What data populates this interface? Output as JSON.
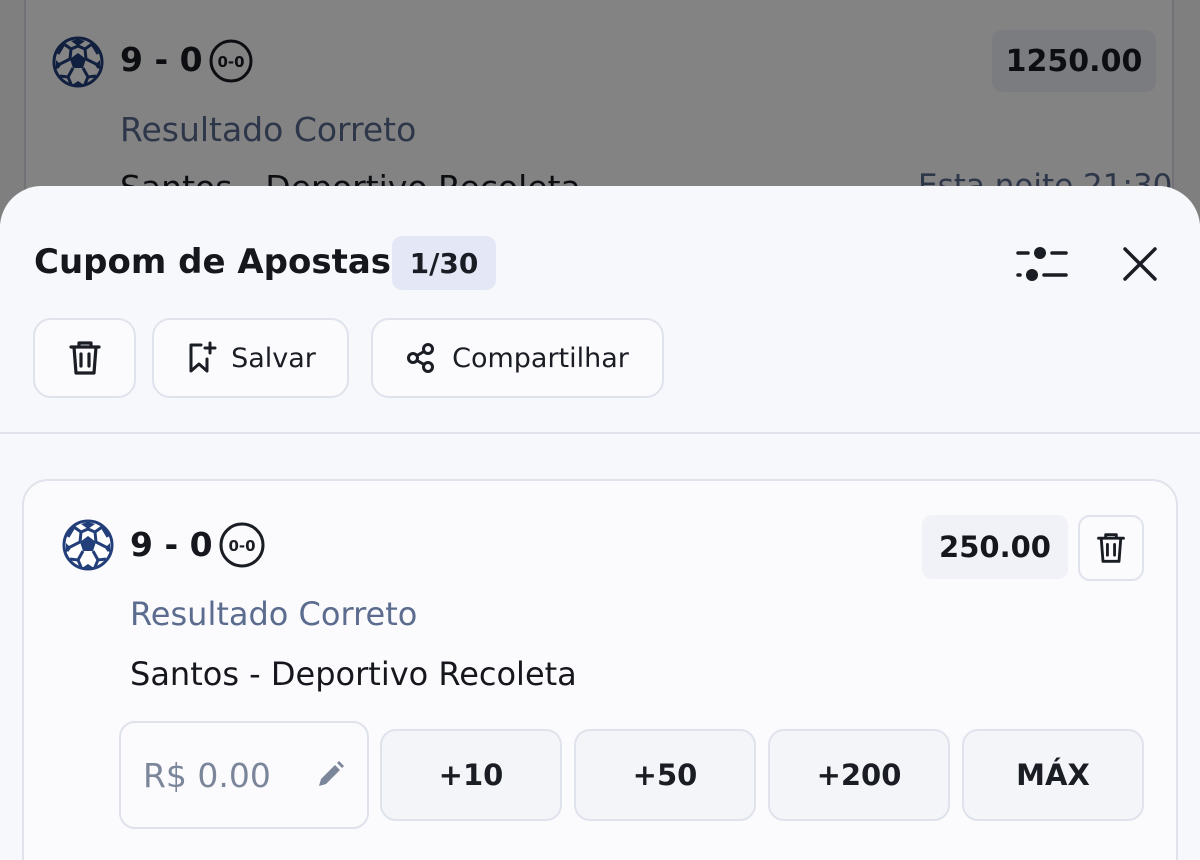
{
  "background_bet": {
    "score": "9 - 0",
    "odd": "1250.00",
    "market": "Resultado Correto",
    "match": "Santos - Deportivo Recoleta",
    "time": "Esta noite 21:30"
  },
  "coupon": {
    "title": "Cupom de Apostas",
    "count": "1/30",
    "actions": {
      "save_label": "Salvar",
      "share_label": "Compartilhar"
    }
  },
  "bet": {
    "score": "9 - 0",
    "score_badge": "0-0",
    "odd": "250.00",
    "market": "Resultado Correto",
    "match": "Santos - Deportivo Recoleta",
    "stake_placeholder": "R$ 0.00",
    "quick_amounts": [
      "+10",
      "+50",
      "+200",
      "MÁX"
    ]
  },
  "icons": {
    "sport": "soccer-ball-icon",
    "live_score": "score-badge-icon",
    "settings": "sliders-icon",
    "close": "close-icon",
    "delete": "trash-icon",
    "save": "bookmark-plus-icon",
    "share": "share-icon",
    "edit": "pencil-icon"
  },
  "colors": {
    "accent_badge": "#e4e8f6",
    "market_text": "#5b6c8e",
    "ball_blue": "#233f7a",
    "overlay": "#000000"
  }
}
